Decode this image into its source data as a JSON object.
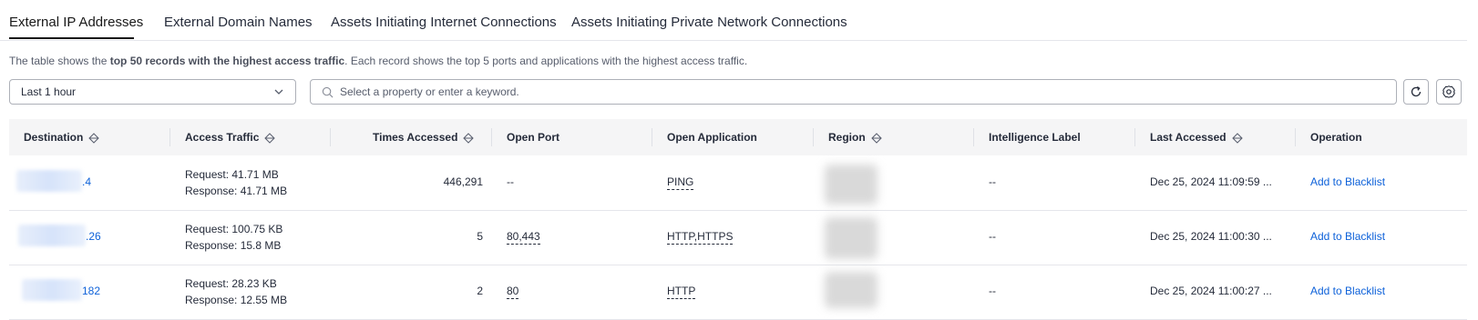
{
  "tabs": [
    {
      "label": "External IP Addresses",
      "active": true
    },
    {
      "label": "External Domain Names",
      "active": false
    },
    {
      "label": "Assets Initiating Internet Connections",
      "active": false
    },
    {
      "label": "Assets Initiating Private Network Connections",
      "active": false
    }
  ],
  "hint": {
    "prefix": "The table shows the ",
    "bold": "top 50 records with the highest access traffic",
    "suffix": ". Each record shows the top 5 ports and applications with the highest access traffic."
  },
  "filter": {
    "time_range": "Last 1 hour"
  },
  "search": {
    "placeholder": "Select a property or enter a keyword.",
    "value": ""
  },
  "columns": {
    "destination": "Destination",
    "access_traffic": "Access Traffic",
    "times_accessed": "Times Accessed",
    "open_port": "Open Port",
    "open_application": "Open Application",
    "region": "Region",
    "intelligence_label": "Intelligence Label",
    "last_accessed": "Last Accessed",
    "operation": "Operation"
  },
  "rows": [
    {
      "destination_suffix": ".4",
      "request": "Request: 41.71 MB",
      "response": "Response: 41.71 MB",
      "times": "446,291",
      "port": "--",
      "app": "PING",
      "intel": "--",
      "last": "Dec 25, 2024 11:09:59 ...",
      "action": "Add to Blacklist"
    },
    {
      "destination_suffix": ".26",
      "request": "Request: 100.75 KB",
      "response": "Response: 15.8 MB",
      "times": "5",
      "port": "80,443",
      "app": "HTTP,HTTPS",
      "intel": "--",
      "last": "Dec 25, 2024 11:00:30 ...",
      "action": "Add to Blacklist"
    },
    {
      "destination_suffix": "182",
      "request": "Request: 28.23 KB",
      "response": "Response: 12.55 MB",
      "times": "2",
      "port": "80",
      "app": "HTTP",
      "intel": "--",
      "last": "Dec 25, 2024 11:00:27 ...",
      "action": "Add to Blacklist"
    }
  ],
  "colors": {
    "link": "#0d61d9",
    "active_tab": "#191919",
    "header_bg": "#f5f5f6"
  },
  "icons": [
    "chevron-down-icon",
    "search-icon",
    "refresh-icon",
    "settings-icon",
    "sort-icon"
  ]
}
